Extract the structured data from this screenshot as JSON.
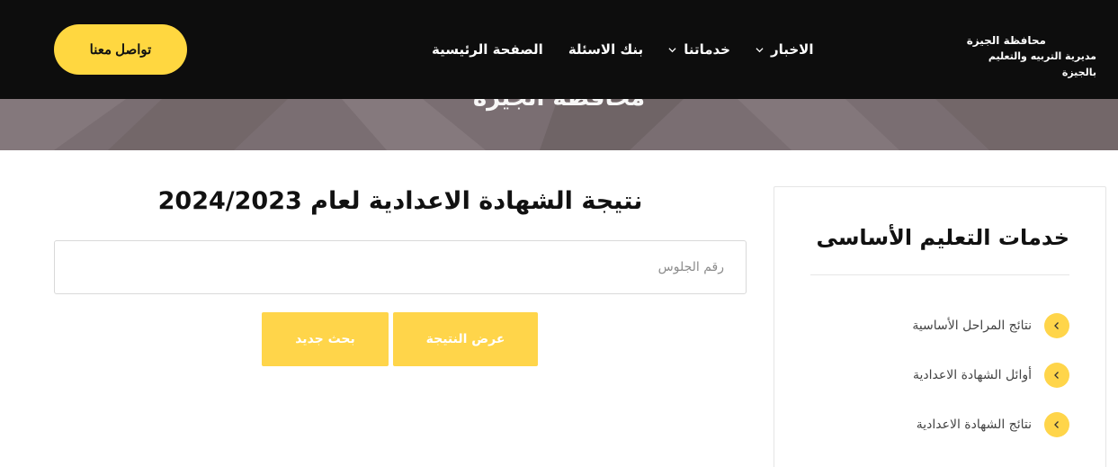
{
  "header": {
    "logo_line1": "محافظة الجيزة",
    "logo_line2": "مديرية التربيه والتعليم بالجيزة",
    "nav": [
      {
        "label": "الصفحة الرئيسية",
        "has_dropdown": false
      },
      {
        "label": "بنك الاسئلة",
        "has_dropdown": false
      },
      {
        "label": "خدماتنا",
        "has_dropdown": true
      },
      {
        "label": "الاخبار",
        "has_dropdown": true
      }
    ],
    "cta_label": "تواصل معنا"
  },
  "banner": {
    "title": "محافظة الجيزة"
  },
  "main": {
    "title": "نتيجة الشهادة الاعدادية لعام 2024/2023",
    "seat_input": {
      "placeholder": "رقم الجلوس",
      "value": ""
    },
    "show_button": "عرض النتيجة",
    "new_search_button": "بحث جديد"
  },
  "sidebar": {
    "title": "خدمات التعليم الأساسى",
    "items": [
      {
        "label": "نتائج المراحل الأساسية"
      },
      {
        "label": "أوائل الشهادة الاعدادية"
      },
      {
        "label": "نتائج الشهادة الاعدادية"
      }
    ]
  },
  "colors": {
    "header_bg": "#0d0d0d",
    "accent_yellow": "#ffd740",
    "banner_bg": "#7a6e72"
  }
}
